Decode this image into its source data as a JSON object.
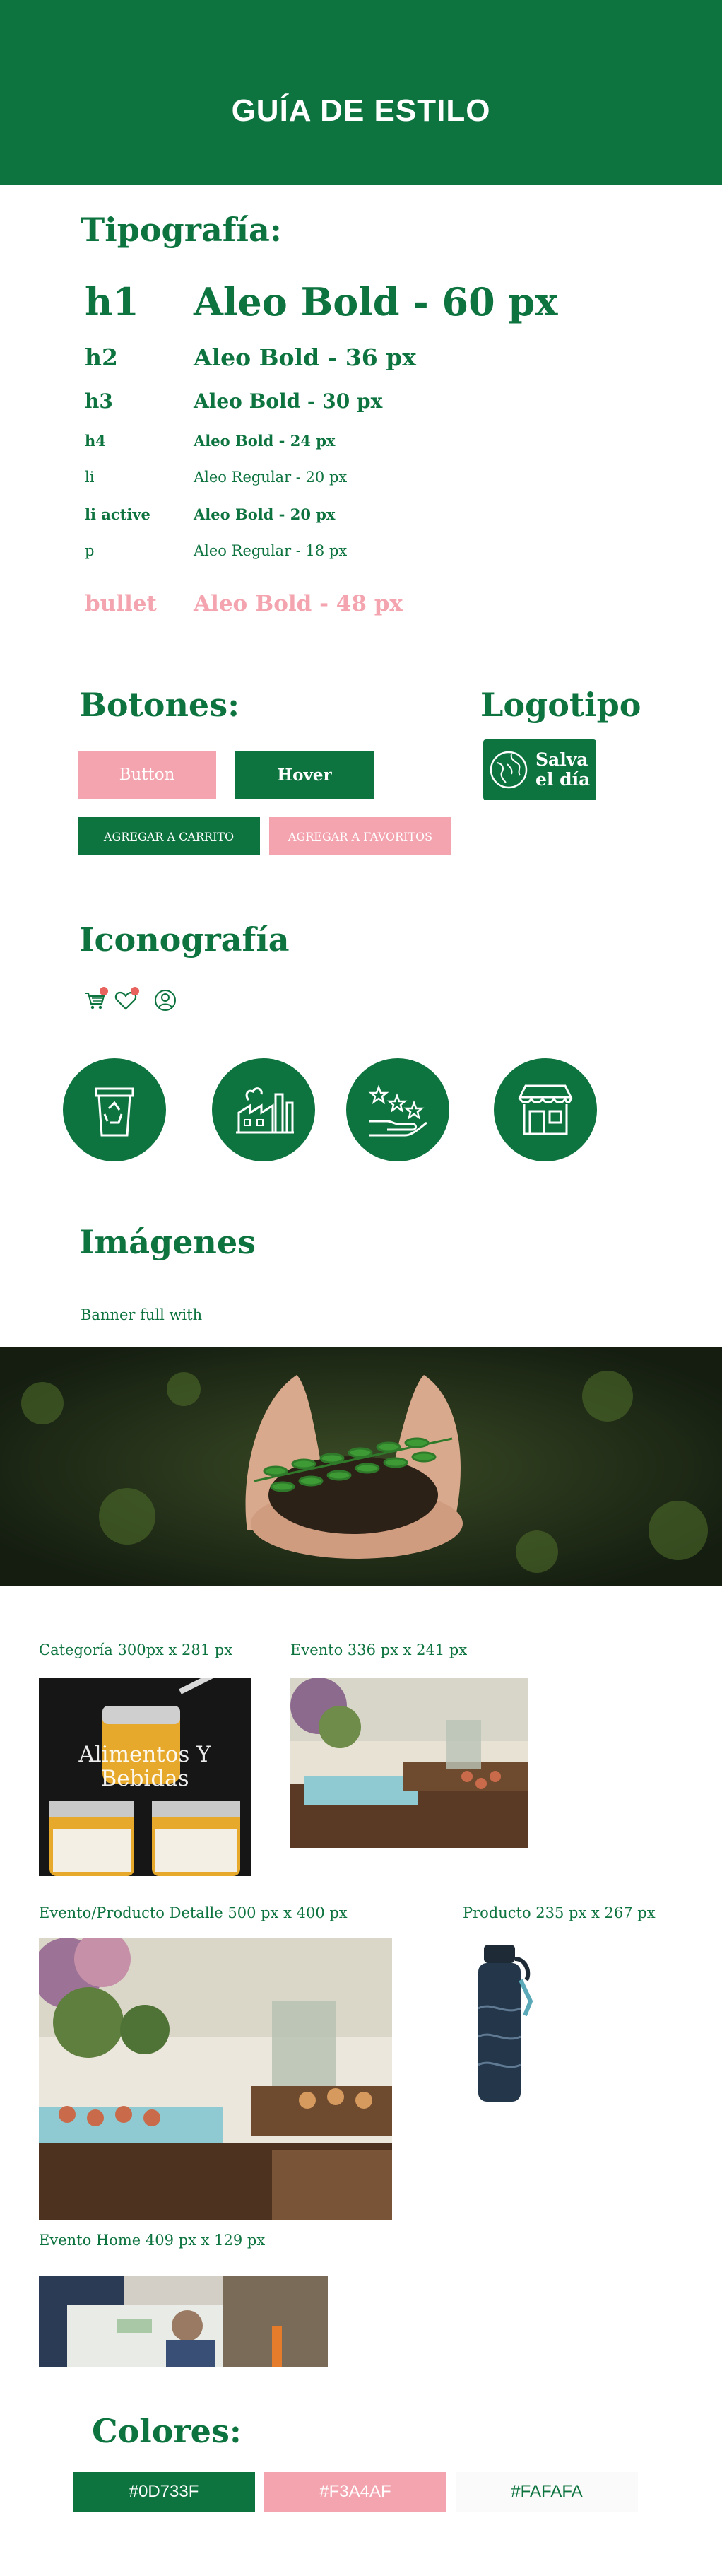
{
  "header": {
    "title": "GUÍA DE ESTILO"
  },
  "typography": {
    "title": "Tipografía:",
    "rows": [
      {
        "tag": "h1",
        "desc": "Aleo Bold - 60 px"
      },
      {
        "tag": "h2",
        "desc": "Aleo Bold - 36 px"
      },
      {
        "tag": "h3",
        "desc": "Aleo Bold - 30 px"
      },
      {
        "tag": "h4",
        "desc": "Aleo Bold - 24 px"
      },
      {
        "tag": "li",
        "desc": "Aleo Regular - 20 px"
      },
      {
        "tag": "li active",
        "desc": "Aleo Bold - 20 px"
      },
      {
        "tag": "p",
        "desc": "Aleo Regular - 18 px"
      },
      {
        "tag": "bullet",
        "desc": "Aleo Bold - 48 px"
      }
    ]
  },
  "buttons": {
    "title": "Botones:",
    "button": "Button",
    "hover": "Hover",
    "add_cart": "AGREGAR A CARRITO",
    "add_fav": "AGREGAR A FAVORITOS"
  },
  "logo": {
    "title": "Logotipo",
    "line1": "Salva",
    "line2": "el día"
  },
  "icons": {
    "title": "Iconografía",
    "small": [
      "cart-icon",
      "heart-icon",
      "user-icon"
    ],
    "big": [
      "recycle-bin-icon",
      "factory-icon",
      "hand-stars-icon",
      "store-icon"
    ]
  },
  "images": {
    "title": "Imágenes",
    "banner_label": "Banner full with",
    "category_label": "Categoría 300px x 281 px",
    "category_overlay": "Alimentos Y Bebidas",
    "event_label": "Evento 336 px x 241 px",
    "detail_label": "Evento/Producto Detalle 500 px x 400 px",
    "product_label": "Producto 235 px x 267 px",
    "home_label": "Evento Home 409 px x 129 px"
  },
  "colors": {
    "title": "Colores:",
    "swatches": [
      {
        "hex": "#0D733F",
        "label": "#0D733F"
      },
      {
        "hex": "#F3A4AF",
        "label": "#F3A4AF"
      },
      {
        "hex": "#FAFAFA",
        "label": "#FAFAFA"
      }
    ]
  }
}
